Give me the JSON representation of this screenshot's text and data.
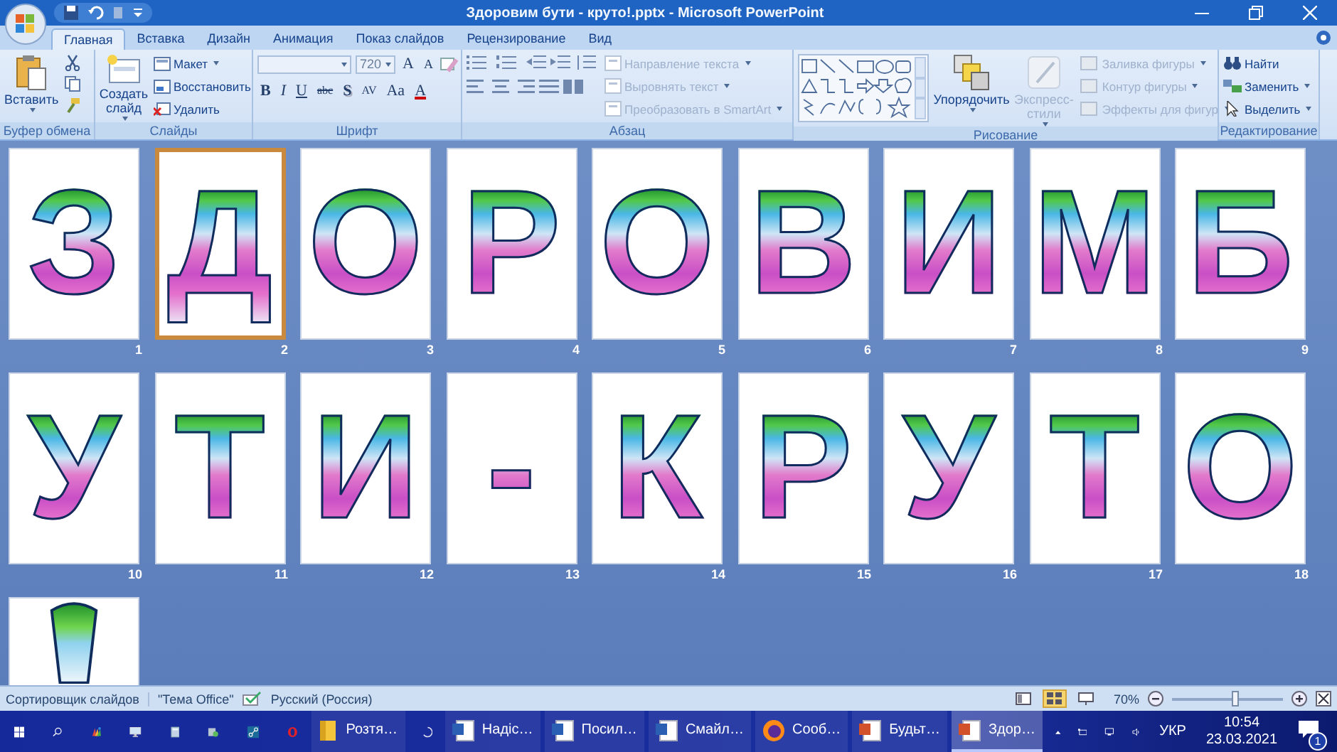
{
  "window": {
    "title": "Здоровим бути - круто!.pptx - Microsoft PowerPoint"
  },
  "tabs": [
    {
      "label": "Главная",
      "selected": true
    },
    {
      "label": "Вставка",
      "selected": false
    },
    {
      "label": "Дизайн",
      "selected": false
    },
    {
      "label": "Анимация",
      "selected": false
    },
    {
      "label": "Показ слайдов",
      "selected": false
    },
    {
      "label": "Рецензирование",
      "selected": false
    },
    {
      "label": "Вид",
      "selected": false
    }
  ],
  "ribbon": {
    "clipboard": {
      "label": "Буфер обмена",
      "paste": "Вставить"
    },
    "slides": {
      "label": "Слайды",
      "new_slide": "Создать слайд",
      "layout": "Макет",
      "reset": "Восстановить",
      "delete": "Удалить"
    },
    "font": {
      "label": "Шрифт",
      "size": "720",
      "size_buttons": [
        {
          "label": "A",
          "kind": "grow"
        },
        {
          "label": "A",
          "kind": "shrink"
        }
      ],
      "format_buttons": [
        {
          "label": "B",
          "kind": "bold"
        },
        {
          "label": "I",
          "kind": "italic"
        },
        {
          "label": "U",
          "kind": "underline"
        },
        {
          "label": "abc",
          "kind": "strike"
        },
        {
          "label": "S",
          "kind": "shadow"
        },
        {
          "label": "AV",
          "kind": "spacing"
        },
        {
          "label": "Aa",
          "kind": "case"
        },
        {
          "label": "A",
          "kind": "color"
        }
      ]
    },
    "paragraph": {
      "label": "Абзац",
      "text_buttons": [
        {
          "label": "Направление текста",
          "disabled": true
        },
        {
          "label": "Выровнять текст",
          "disabled": true
        },
        {
          "label": "Преобразовать в SmartArt",
          "disabled": true
        }
      ]
    },
    "drawing": {
      "label": "Рисование",
      "arrange": "Упорядочить",
      "quick_styles": {
        "label": "Экспресс-стили",
        "disabled": true
      },
      "shape_buttons": [
        {
          "label": "Заливка фигуры",
          "disabled": true
        },
        {
          "label": "Контур фигуры",
          "disabled": true
        },
        {
          "label": "Эффекты для фигур",
          "disabled": true
        }
      ]
    },
    "editing": {
      "label": "Редактирование",
      "buttons": [
        "Найти",
        "Заменить",
        "Выделить"
      ]
    }
  },
  "slides": [
    {
      "kind": "letter",
      "number": "1",
      "letter": "З",
      "selected": false
    },
    {
      "kind": "letter",
      "number": "2",
      "letter": "Д",
      "selected": true
    },
    {
      "kind": "letter",
      "number": "3",
      "letter": "О",
      "selected": false
    },
    {
      "kind": "letter",
      "number": "4",
      "letter": "Р",
      "selected": false
    },
    {
      "kind": "letter",
      "number": "5",
      "letter": "О",
      "selected": false
    },
    {
      "kind": "letter",
      "number": "6",
      "letter": "В",
      "selected": false
    },
    {
      "kind": "letter",
      "number": "7",
      "letter": "И",
      "selected": false
    },
    {
      "kind": "letter",
      "number": "8",
      "letter": "М",
      "selected": false
    },
    {
      "kind": "letter",
      "number": "9",
      "letter": "Б",
      "selected": false
    },
    {
      "kind": "letter",
      "number": "10",
      "letter": "У",
      "selected": false
    },
    {
      "kind": "letter",
      "number": "11",
      "letter": "Т",
      "selected": false
    },
    {
      "kind": "letter",
      "number": "12",
      "letter": "И",
      "selected": false
    },
    {
      "kind": "letter",
      "number": "13",
      "letter": "-",
      "selected": false
    },
    {
      "kind": "letter",
      "number": "14",
      "letter": "К",
      "selected": false
    },
    {
      "kind": "letter",
      "number": "15",
      "letter": "Р",
      "selected": false
    },
    {
      "kind": "letter",
      "number": "16",
      "letter": "У",
      "selected": false
    },
    {
      "kind": "letter",
      "number": "17",
      "letter": "Т",
      "selected": false
    },
    {
      "kind": "letter",
      "number": "18",
      "letter": "О",
      "selected": false
    },
    {
      "kind": "cut",
      "selected": false
    }
  ],
  "status_bar": {
    "view": "Сортировщик слайдов",
    "theme": "\"Тема Office\"",
    "language": "Русский (Россия)",
    "views": [
      {
        "kind": "normal",
        "selected": false
      },
      {
        "kind": "sorter",
        "selected": true
      },
      {
        "kind": "show",
        "selected": false
      }
    ],
    "zoom": "70%",
    "zoom_slider": {
      "level": 0.58
    }
  },
  "taskbar": {
    "tasks": [
      {
        "kind": "folder",
        "label": "Розтя…",
        "active": false
      },
      {
        "kind": "loading",
        "active": false
      },
      {
        "kind": "doc",
        "label": "Надіс…",
        "active": false
      },
      {
        "kind": "doc",
        "label": "Посил…",
        "active": false
      },
      {
        "kind": "doc",
        "label": "Смайл…",
        "active": false
      },
      {
        "kind": "firefox",
        "label": "Сооб…",
        "active": false
      },
      {
        "kind": "ppt",
        "label": "Будьт…",
        "active": false
      },
      {
        "kind": "ppt",
        "label": "Здор…",
        "active": true
      }
    ],
    "tray": {
      "language": "УКР",
      "time": "10:54",
      "date": "23.03.2021",
      "notifications": "1"
    }
  }
}
